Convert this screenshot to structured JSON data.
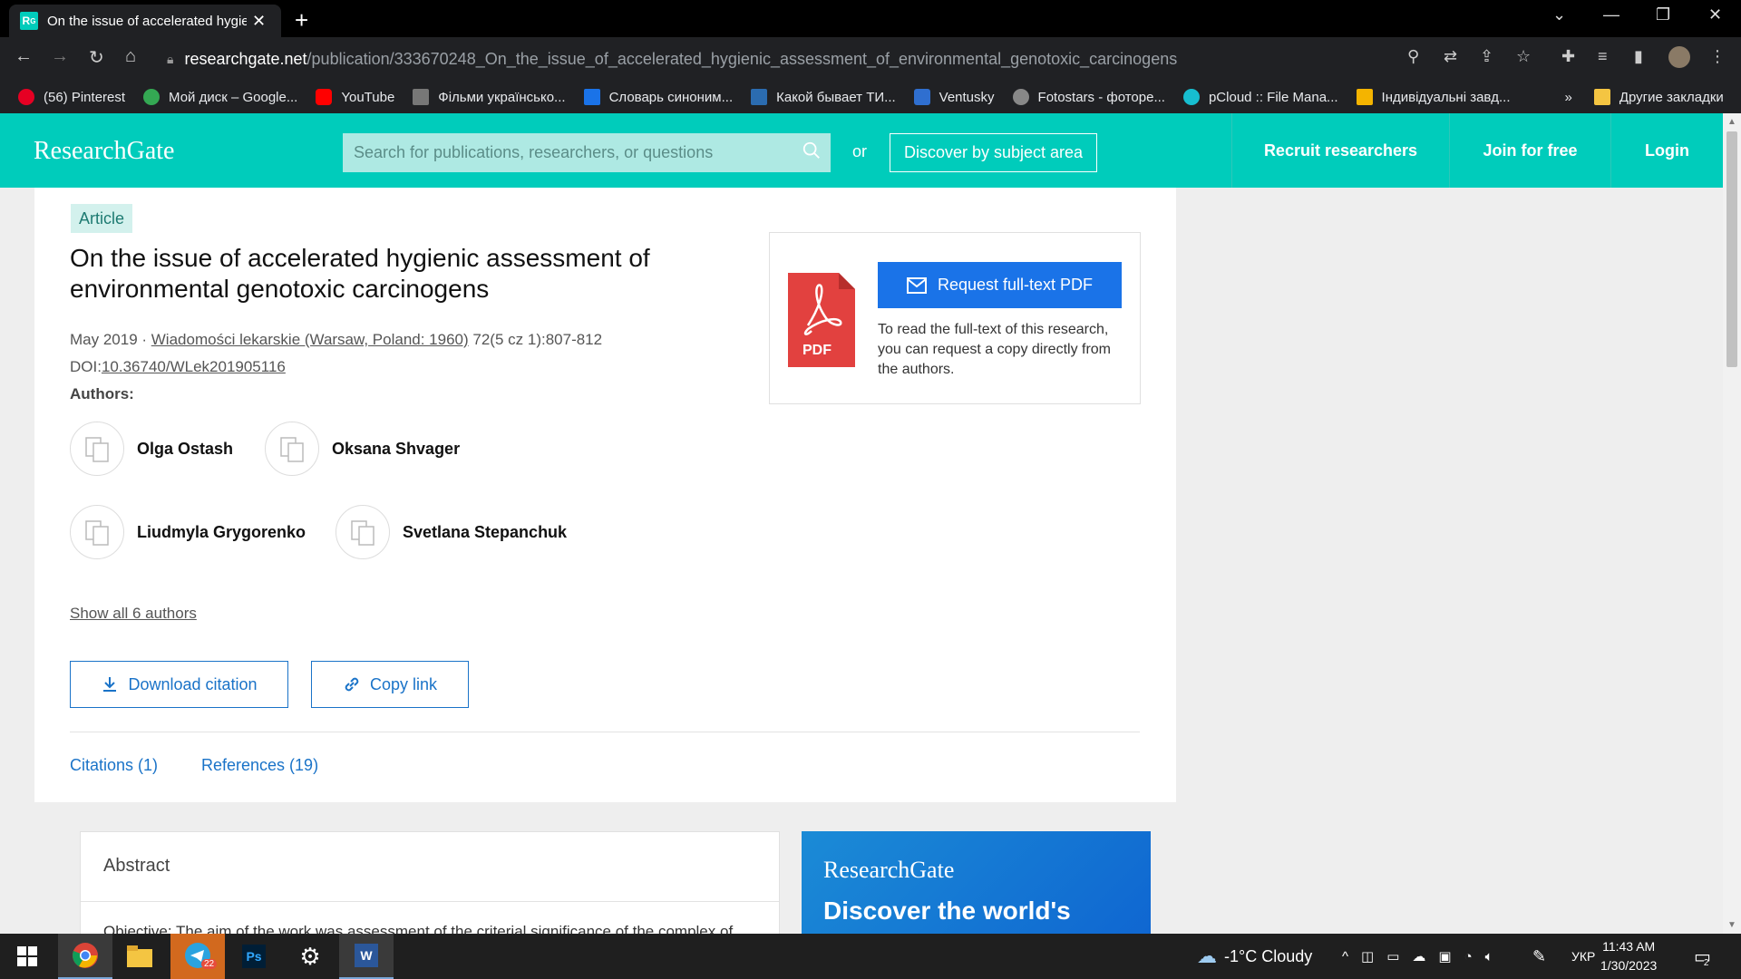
{
  "browser": {
    "tab_title": "On the issue of accelerated hygie",
    "url_host": "researchgate.net",
    "url_path": "/publication/333670248_On_the_issue_of_accelerated_hygienic_assessment_of_environmental_genotoxic_carcinogens",
    "bookmarks": [
      {
        "label": "(56) Pinterest",
        "color": "#e60023"
      },
      {
        "label": "Мой диск – Google...",
        "color": "#34a853"
      },
      {
        "label": "YouTube",
        "color": "#ff0000"
      },
      {
        "label": "Фільми українсько...",
        "color": "#777777"
      },
      {
        "label": "Словарь синоним...",
        "color": "#1a73e8"
      },
      {
        "label": "Какой бывает ТИ...",
        "color": "#2b6cb0"
      },
      {
        "label": "Ventusky",
        "color": "#2f6fd0"
      },
      {
        "label": "Fotostars - фоторе...",
        "color": "#888888"
      },
      {
        "label": "pCloud :: File Mana...",
        "color": "#17bed0"
      },
      {
        "label": "Індивідуальні завд...",
        "color": "#f4b400"
      }
    ],
    "more_bookmarks": "»",
    "other_bookmarks": "Другие закладки"
  },
  "header": {
    "logo": "ResearchGate",
    "search_placeholder": "Search for publications, researchers, or questions",
    "or": "or",
    "discover": "Discover by subject area",
    "recruit": "Recruit researchers",
    "join": "Join for free",
    "login": "Login"
  },
  "article": {
    "badge": "Article",
    "title": "On the issue of accelerated hygienic assessment of environmental genotoxic carcinogens",
    "date": "May 2019 · ",
    "journal": "Wiadomości lekarskie (Warsaw, Poland: 1960)",
    "issue": " 72(5 cz 1):807-812",
    "doi_label": "DOI:",
    "doi": "10.36740/WLek201905116",
    "authors_label": "Authors:",
    "authors": [
      "Olga Ostash",
      "Oksana Shvager",
      "Liudmyla Grygorenko",
      "Svetlana Stepanchuk"
    ],
    "show_all": "Show all 6 authors",
    "download_citation": "Download citation",
    "copy_link": "Copy link",
    "citations_tab": "Citations (1)",
    "references_tab": "References (19)"
  },
  "pdf_box": {
    "icon_label": "PDF",
    "button": "Request full-text PDF",
    "text": "To read the full-text of this research, you can request a copy directly from the authors."
  },
  "abstract": {
    "heading": "Abstract",
    "text": "Objective: The aim of the work was assessment of the criterial significance of the complex of"
  },
  "promo": {
    "logo": "ResearchGate",
    "text": "Discover the world's"
  },
  "taskbar": {
    "telegram_badge": "22",
    "weather": "-1°C  Cloudy",
    "lang": "УКР",
    "time": "11:43 AM",
    "date": "1/30/2023",
    "notif_count": "2"
  }
}
